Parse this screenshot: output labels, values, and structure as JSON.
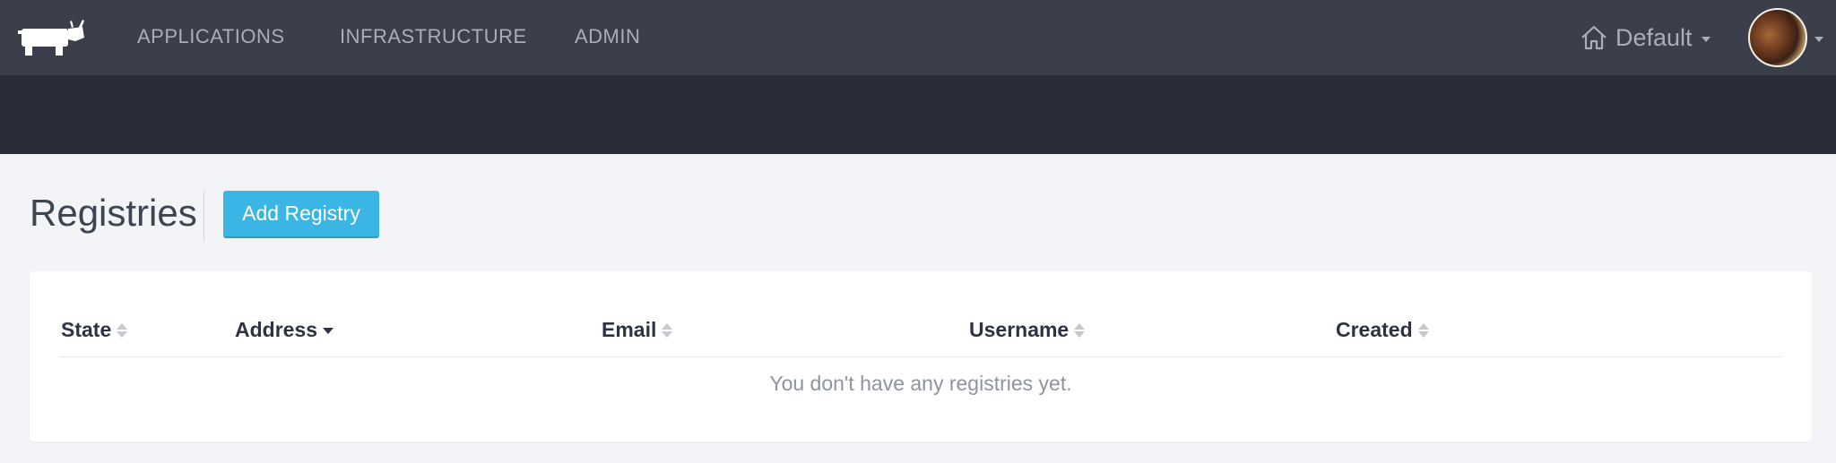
{
  "nav": {
    "items": [
      {
        "label": "APPLICATIONS"
      },
      {
        "label": "INFRASTRUCTURE"
      },
      {
        "label": "ADMIN"
      }
    ],
    "environment": "Default"
  },
  "page": {
    "title": "Registries",
    "add_button_label": "Add Registry"
  },
  "table": {
    "columns": [
      {
        "label": "State"
      },
      {
        "label": "Address"
      },
      {
        "label": "Email"
      },
      {
        "label": "Username"
      },
      {
        "label": "Created"
      }
    ],
    "sorted_column": "Address",
    "empty_message": "You don't have any registries yet."
  },
  "colors": {
    "topbar": "#3a3f4b",
    "subbar": "#2a2d38",
    "accent": "#3bb6e4",
    "background": "#f2f4f8"
  },
  "icons": {
    "logo": "rancher-cow-logo",
    "environment": "home-icon",
    "user": "user-avatar"
  }
}
